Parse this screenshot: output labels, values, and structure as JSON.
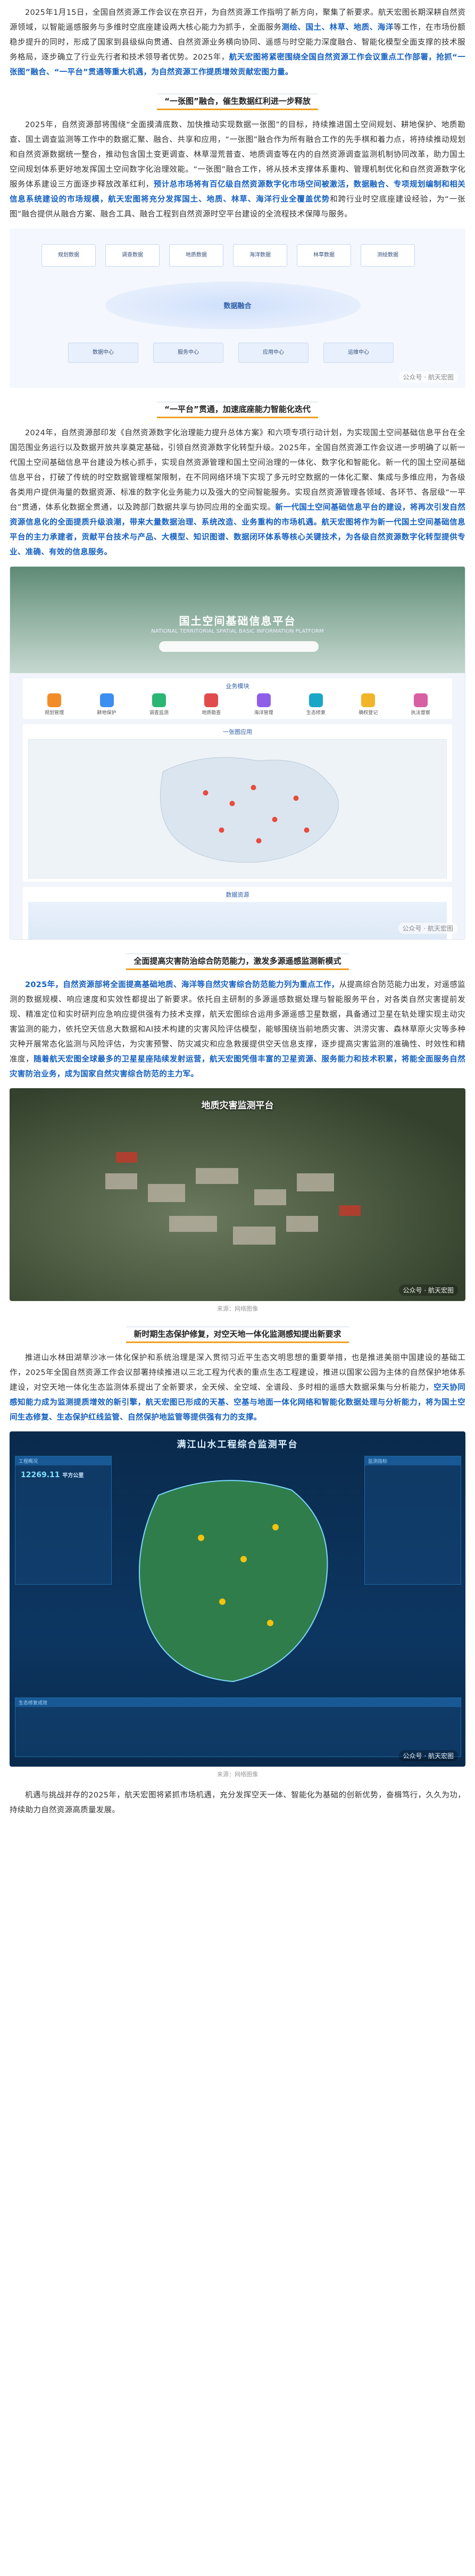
{
  "paragraphs": {
    "p1_a": "2025年1月15日，全国自然资源工作会议在京召开，为自然资源工作指明了新方向，聚集了新要求。航天宏图长期深耕自然资源领域，以智能遥感服务与多维时空底座建设两大核心能力为抓手，全面服务",
    "p1_hl1": "测绘、国土、林草、地质、海洋",
    "p1_b": "等工作，在市场份额稳步提升的同时，形成了国家到县级纵向贯通、自然资源业务横向协同、遥感与时空能力深度融合、智能化模型全面支撑的技术服务格局，逐步确立了行业先行者和技术领导者优势。2025年，",
    "p1_hl2": "航天宏图将紧密围绕全国自然资源工作会议重点工作部署，抢抓“一张图”融合、“一平台”贯通等重大机遇，为自然资源工作提质增效贡献宏图力量。",
    "p2_a": "2025年，自然资源部将围绕“全面摸清底数、加快推动实现数据一张图”的目标，持续推进国土空间规划、耕地保护、地质勘查、国土调查监测等工作中的数据汇聚、融合、共享和应用，“一张图”融合作为所有融合工作的先手棋和着力点，将持续推动规划和自然资源数据统一整合，推动包含国土变更调查、林草湿荒普查、地质调查等在内的自然资源调查监测机制协同改革，助力国土空间规划体系更好地发挥国土空间数字化治理效能。“一张图”融合工作，将从技术支撑体系重构、管理机制优化和自然资源数字化服务体系建设三方面逐步释放改革红利，",
    "p2_hl": "预计总市场将有百亿级自然资源数字化市场空间被激活，数据融合、专项规划编制和相关信息系统建设的市场规模，航天宏图将充分发挥国土、地质、林草、海洋行业全覆盖优势",
    "p2_b": "和跨行业时空底座建设经验，为“一张图”融合提供从融合方案、融合工具、融合工程到自然资源时空平台建设的全流程技术保障与服务。",
    "p3_a": "2024年，自然资源部印发《自然资源数字化治理能力提升总体方案》和六项专项行动计划，为实现国土空间基础信息平台在全国范围业务运行以及数据开放共享奠定基础，引领自然资源数字化转型升级。2025年，全国自然资源工作会议进一步明确了以新一代国土空间基础信息平台建设为核心抓手，实现自然资源管理和国土空间治理的一体化、数字化和智能化。新一代的国土空间基础信息平台，打破了传统的时空数据管理框架限制，在不同网络环境下实现了多元时空数据的一体化汇聚、集成与多维应用，为各级各类用户提供海量的数据资源、标准的数字化业务能力以及强大的空间智能服务。实现自然资源管理各领域、各环节、各层级“一平台”贯通，体系化数据全贯通，以及跨部门数据共享与协同应用的全面实现。",
    "p3_hl": "新一代国土空间基础信息平台的建设，将再次引发自然资源信息化的全面提质升级浪潮，带来大量数据治理、系统改造、业务重构的市场机遇。航天宏图将作为新一代国土空间基础信息平台的主力承建者，贡献平台技术与产品、大模型、知识图谱、数据闭环体系等核心关键技术，为各级自然资源数字化转型提供专业、准确、有效的信息服务。",
    "p4_hl": "2025年，自然资源部将全面提高基础地质、海洋等自然灾害综合防范能力列为重点工作，",
    "p4_a": "从提高综合防范能力出发，对遥感监测的数据规模、响应速度和实效性都提出了新要求。依托自主研制的多源遥感数据处理与智能服务平台，对各类自然灾害提前发现、精准定位和实时研判应急响应提供强有力技术支撑，航天宏图综合运用多源遥感卫星数据，具备通过卫星在轨处理实现主动灾害监测的能力，依托空天信息大数据和AI技术构建的灾害风险评估模型，能够围绕当前地质灾害、洪涝灾害、森林草原火灾等多种灾种开展常态化监测与风险评估，为灾害预警、防灾减灾和应急救援提供空天信息支撑，逐步提高灾害监测的准确性、时效性和精准度，",
    "p4_hl2": "随着航天宏图全球最多的卫星星座陆续发射运营，航天宏图凭借丰富的卫星资源、服务能力和技术积累，将能全面服务自然灾害防治业务，成为国家自然灾害综合防范的主力军。",
    "p5_a": "推进山水林田湖草沙冰一体化保护和系统治理是深入贯彻习近平生态文明思想的重要举措，也是推进美丽中国建设的基础工作，2025年全国自然资源工作会议部署持续推进以三北工程为代表的重点生态工程建设，推进以国家公园为主体的自然保护地体系建设，对空天地一体化生态监测体系提出了全新要求，全天候、全空域、全谱段、多时相的遥感大数据采集与分析能力，",
    "p5_hl": "空天协同感知能力成为监测提质增效的新引擎，航天宏图已形成的天基、空基与地面一体化网络和智能化数据处理与分析能力，将为国土空间生态修复、生态保护红线监管、自然保护地监管等提供强有力的支撑。",
    "p6": "机遇与挑战并存的2025年，航天宏图将紧抓市场机遇，充分发挥空天一体、智能化为基础的创新优势，奋楫笃行，久久为功，持续助力自然资源高质量发展。"
  },
  "sections": {
    "s1": "“一张图”融合，催生数据红利进一步释放",
    "s2": "“一平台”贯通，加速底座能力智能化迭代",
    "s3": "全面提高灾害防治综合防范能力，激发多源遥感监测新模式",
    "s4": "新时期生态保护修复，对空天地一体化监测感知提出新要求"
  },
  "figures": {
    "diagram1": {
      "top_boxes": [
        "规划数据",
        "调查数据",
        "地质数据",
        "海洋数据",
        "林草数据",
        "测绘数据"
      ],
      "center_label": "数据融合",
      "bottom_boxes": [
        "数据中心",
        "服务中心",
        "应用中心",
        "运维中心"
      ],
      "watermark": "公众号 · 航天宏图"
    },
    "platform": {
      "title": "国土空间基础信息平台",
      "subtitle": "NATIONAL TERRITORIAL SPATIAL BASIC INFORMATION PLATFORM",
      "services_head": "业务模块",
      "services": [
        "规划管理",
        "耕地保护",
        "调查监测",
        "地质勘查",
        "海洋管理",
        "生态修复",
        "确权登记",
        "执法督察"
      ],
      "map_head": "一张图应用",
      "data_head": "数据资源",
      "watermark": "公众号 · 航天宏图"
    },
    "aerial": {
      "title": "地质灾害监测平台",
      "caption": "来源：网络图像",
      "watermark": "公众号 · 航天宏图"
    },
    "monitor": {
      "title": "满江山水工程综合监测平台",
      "left_panel": "工程概况",
      "right_panel": "监测指标",
      "bottom_panel": "生态修复成效",
      "stat_value": "12269.11",
      "stat_unit": "平方公里",
      "caption": "来源：网络图像",
      "watermark": "公众号 · 航天宏图"
    }
  }
}
